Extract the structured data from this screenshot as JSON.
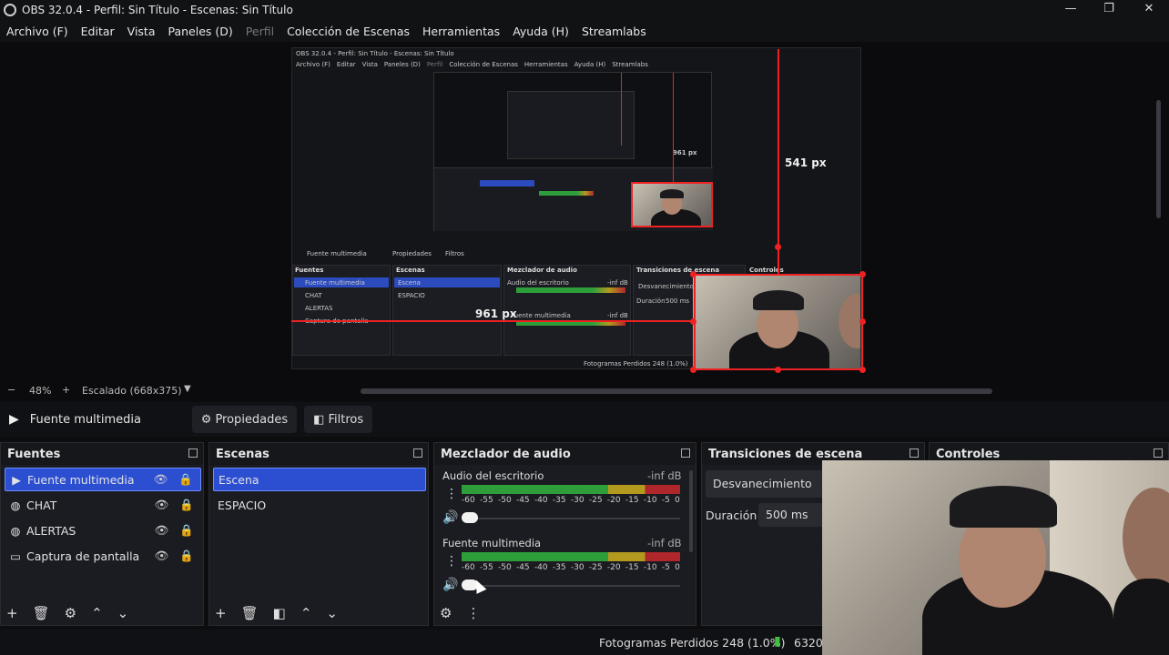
{
  "window": {
    "title": "OBS 32.0.4 - Perfil: Sin Título - Escenas: Sin Título",
    "nested_title": "OBS 32.0.4 - Perfil: Sin Título - Escenas: Sin Título"
  },
  "menu": {
    "archivo": "Archivo (F)",
    "editar": "Editar",
    "vista": "Vista",
    "paneles": "Paneles (D)",
    "perfil": "Perfil",
    "coleccion": "Colección de Escenas",
    "herramientas": "Herramientas",
    "ayuda": "Ayuda (H)",
    "streamlabs": "Streamlabs"
  },
  "nested_menu": {
    "archivo": "Archivo (F)",
    "editar": "Editar",
    "vista": "Vista",
    "paneles": "Paneles (D)",
    "perfil": "Perfil",
    "coleccion": "Colección de Escenas",
    "herramientas": "Herramientas",
    "ayuda": "Ayuda (H)",
    "streamlabs": "Streamlabs"
  },
  "nested": {
    "source": "Fuente multimedia",
    "props": "Propiedades",
    "filters": "Filtros",
    "fuentes": "Fuentes",
    "escenas": "Escenas",
    "mezclador": "Mezclador de audio",
    "transiciones": "Transiciones de escena",
    "controles": "Controles",
    "src_items": [
      "Fuente multimedia",
      "CHAT",
      "ALERTAS",
      "Captura de pantalla"
    ],
    "scene_items": [
      "Escena",
      "ESPACIO"
    ],
    "audio1": "Audio del escritorio",
    "audio2": "Fuente multimedia",
    "inf": "-inf dB",
    "fade": "Desvanecimiento",
    "duracion": "Duración",
    "ms": "500 ms",
    "status": "Fotogramas Perdidos 248 (1.0%)",
    "small_measure": "961 px"
  },
  "measure": {
    "vertical": "541 px",
    "horizontal": "961 px",
    "tiny": "961 px"
  },
  "scale": {
    "zoom": "48%",
    "scaled": "Escalado (668x375)"
  },
  "source_toolbar": {
    "source_name": "Fuente multimedia",
    "properties": "Propiedades",
    "filters": "Filtros"
  },
  "fuentes": {
    "title": "Fuentes",
    "items": [
      {
        "label": "Fuente multimedia",
        "icon": "play-icon"
      },
      {
        "label": "CHAT",
        "icon": "globe-icon"
      },
      {
        "label": "ALERTAS",
        "icon": "globe-icon"
      },
      {
        "label": "Captura de pantalla",
        "icon": "monitor-icon"
      }
    ]
  },
  "escenas": {
    "title": "Escenas",
    "items": [
      "Escena",
      "ESPACIO"
    ]
  },
  "mezclador": {
    "title": "Mezclador de audio",
    "ch1": {
      "name": "Audio del escritorio",
      "level": "-inf dB"
    },
    "ch2": {
      "name": "Fuente multimedia",
      "level": "-inf dB"
    },
    "ticks": [
      "-60",
      "-55",
      "-50",
      "-45",
      "-40",
      "-35",
      "-30",
      "-25",
      "-20",
      "-15",
      "-10",
      "-5",
      "0"
    ]
  },
  "transiciones": {
    "title": "Transiciones de escena",
    "transition": "Desvanecimiento",
    "duration_label": "Duración",
    "duration_value": "500 ms"
  },
  "controles": {
    "title": "Controles"
  },
  "status": {
    "dropped": "Fotogramas Perdidos 248 (1.0%)",
    "bitrate": "6320 k"
  },
  "colors": {
    "selection": "#2c4fd2",
    "measure_red": "#e22222",
    "meter_green": "#2e9e3a",
    "meter_yellow": "#b39a1f",
    "meter_red": "#b0272b"
  }
}
